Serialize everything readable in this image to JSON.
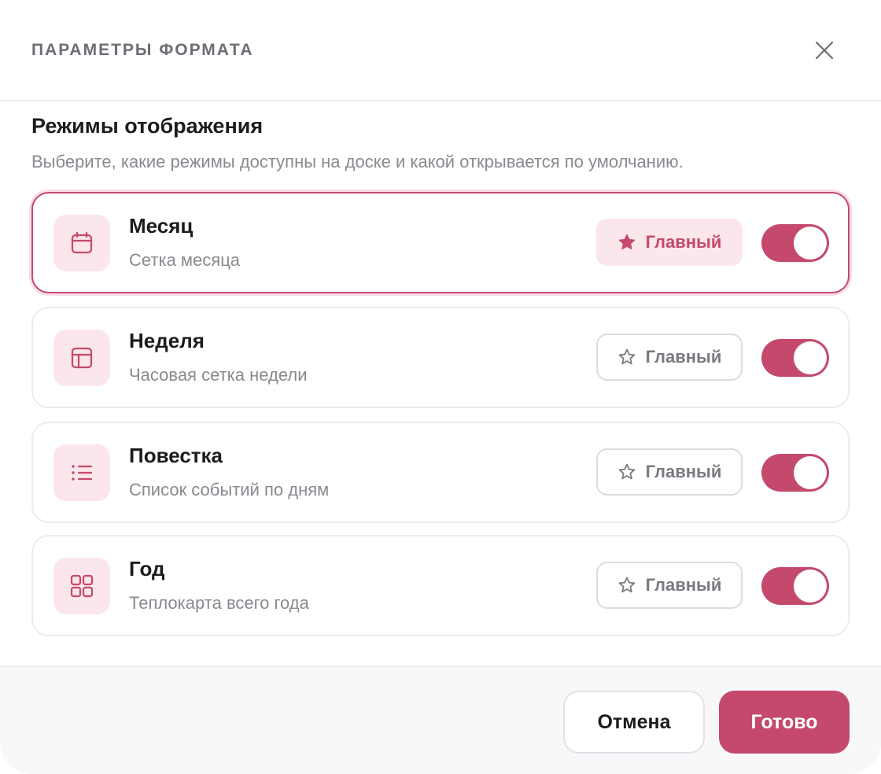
{
  "dialog": {
    "title": "ПАРАМЕТРЫ ФОРМАТА",
    "close_icon": "close-icon"
  },
  "section": {
    "title": "Режимы отображения",
    "description": "Выберите, какие режимы доступны на доске и какой открывается по умолчанию."
  },
  "modes": [
    {
      "name": "Месяц",
      "description": "Сетка месяца",
      "icon": "calendar-icon",
      "primary_label": "Главный",
      "is_primary": true,
      "enabled": true
    },
    {
      "name": "Неделя",
      "description": "Часовая сетка недели",
      "icon": "layout-icon",
      "primary_label": "Главный",
      "is_primary": false,
      "enabled": true
    },
    {
      "name": "Повестка",
      "description": "Список событий по дням",
      "icon": "list-icon",
      "primary_label": "Главный",
      "is_primary": false,
      "enabled": true
    },
    {
      "name": "Год",
      "description": "Теплокарта всего года",
      "icon": "grid-icon",
      "primary_label": "Главный",
      "is_primary": false,
      "enabled": true
    }
  ],
  "footer": {
    "cancel_label": "Отмена",
    "done_label": "Готово"
  },
  "colors": {
    "accent": "#c4496c",
    "accent_soft": "#fbe6ec",
    "muted_text": "#8a8990",
    "border": "#ececef"
  }
}
